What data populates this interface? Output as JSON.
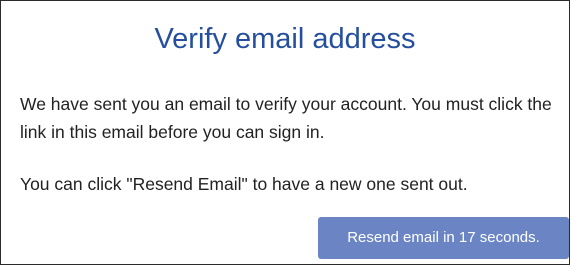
{
  "dialog": {
    "title": "Verify email address",
    "message": "We have sent you an email to verify your account. You must click the link in this email before you can sign in.",
    "hint": "You can click \"Resend Email\" to have a new one sent out.",
    "resend_button_label": "Resend email in 17 seconds."
  },
  "colors": {
    "title": "#254f9e",
    "button_bg": "#6b85c4",
    "text": "#222222"
  }
}
